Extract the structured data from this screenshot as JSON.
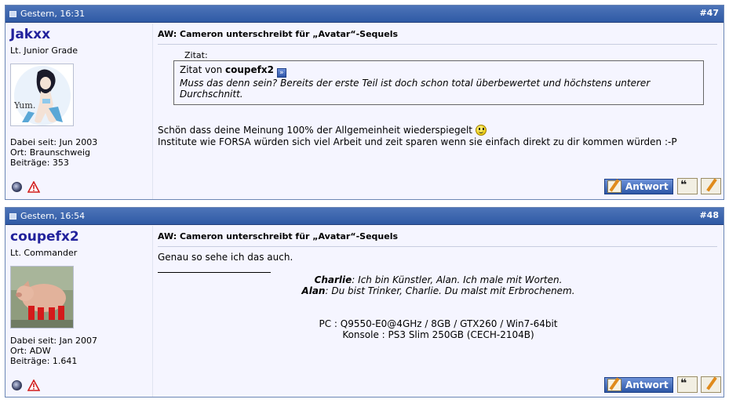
{
  "posts": [
    {
      "date": "Gestern, 16:31",
      "number": "#47",
      "username": "Jakxx",
      "usertitle": "Lt. Junior Grade",
      "avatar_text": "Yum.",
      "joined": "Dabei seit: Jun 2003",
      "location": "Ort: Braunschweig",
      "posts": "Beiträge: 353",
      "title": "AW: Cameron unterschreibt für „Avatar“-Sequels",
      "quote_label": "Zitat:",
      "quote_from_prefix": "Zitat von ",
      "quote_author": "coupefx2",
      "quote_text_line1": "Muss das denn sein? Bereits der erste Teil ist doch schon total überbewertet und höchstens unterer",
      "quote_text_line2": "Durchschnitt.",
      "message_line1": "Schön dass deine Meinung 100% der Allgemeinheit wiederspiegelt",
      "message_line2": "Institute wie FORSA würden sich viel Arbeit und zeit sparen wenn sie einfach direkt zu dir kommen würden :-P",
      "reply_label": "Antwort"
    },
    {
      "date": "Gestern, 16:54",
      "number": "#48",
      "username": "coupefx2",
      "usertitle": "Lt. Commander",
      "joined": "Dabei seit: Jan 2007",
      "location": "Ort: ADW",
      "posts": "Beiträge: 1.641",
      "title": "AW: Cameron unterschreibt für „Avatar“-Sequels",
      "message_line1": "Genau so sehe ich das auch.",
      "sig_line1_name": "Charlie",
      "sig_line1_text": ": Ich bin Künstler, Alan. Ich male mit Worten.",
      "sig_line2_name": "Alan",
      "sig_line2_text": ": Du bist Trinker, Charlie. Du malst mit Erbrochenem.",
      "sig_pc": "PC : Q9550-E0@4GHz / 8GB / GTX260 / Win7-64bit",
      "sig_console": "Konsole : PS3 Slim 250GB (CECH-2104B)",
      "reply_label": "Antwort"
    }
  ],
  "colors": {
    "header": "#2f5aa5",
    "username": "#22229c",
    "background": "#f5f5ff"
  }
}
